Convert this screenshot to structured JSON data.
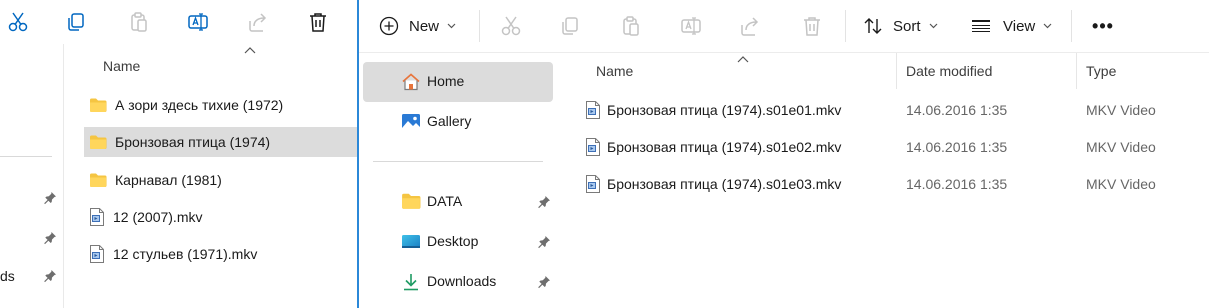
{
  "left_window": {
    "column_name": "Name",
    "quick_access_partial": [
      "",
      "",
      "ds"
    ],
    "items": [
      {
        "label": "А зори здесь тихие (1972)",
        "kind": "folder",
        "selected": false
      },
      {
        "label": "Бронзовая птица (1974)",
        "kind": "folder",
        "selected": true
      },
      {
        "label": "Карнавал (1981)",
        "kind": "folder",
        "selected": false
      },
      {
        "label": "12 (2007).mkv",
        "kind": "video",
        "selected": false
      },
      {
        "label": "12 стульев (1971).mkv",
        "kind": "video",
        "selected": false
      }
    ]
  },
  "toolbar": {
    "new_label": "New",
    "sort_label": "Sort",
    "view_label": "View",
    "more_label": "•••"
  },
  "nav": {
    "items": [
      {
        "label": "Home",
        "icon": "home-icon",
        "active": true,
        "pinned": false
      },
      {
        "label": "Gallery",
        "icon": "gallery-icon",
        "active": false,
        "pinned": false
      },
      {
        "label": "DATA",
        "icon": "folder-icon",
        "active": false,
        "pinned": true
      },
      {
        "label": "Desktop",
        "icon": "desktop-icon",
        "active": false,
        "pinned": true
      },
      {
        "label": "Downloads",
        "icon": "download-icon",
        "active": false,
        "pinned": true
      }
    ]
  },
  "content": {
    "columns": {
      "name": "Name",
      "date": "Date modified",
      "type": "Type"
    },
    "files": [
      {
        "name": "Бронзовая птица (1974).s01e01.mkv",
        "date": "14.06.2016 1:35",
        "type": "MKV Video"
      },
      {
        "name": "Бронзовая птица (1974).s01e02.mkv",
        "date": "14.06.2016 1:35",
        "type": "MKV Video"
      },
      {
        "name": "Бронзовая птица (1974).s01e03.mkv",
        "date": "14.06.2016 1:35",
        "type": "MKV Video"
      }
    ]
  },
  "colors": {
    "accent": "#0067c0",
    "selection": "#dcdcdc",
    "folder": "#f5c542",
    "divider": "#2b88d8"
  }
}
